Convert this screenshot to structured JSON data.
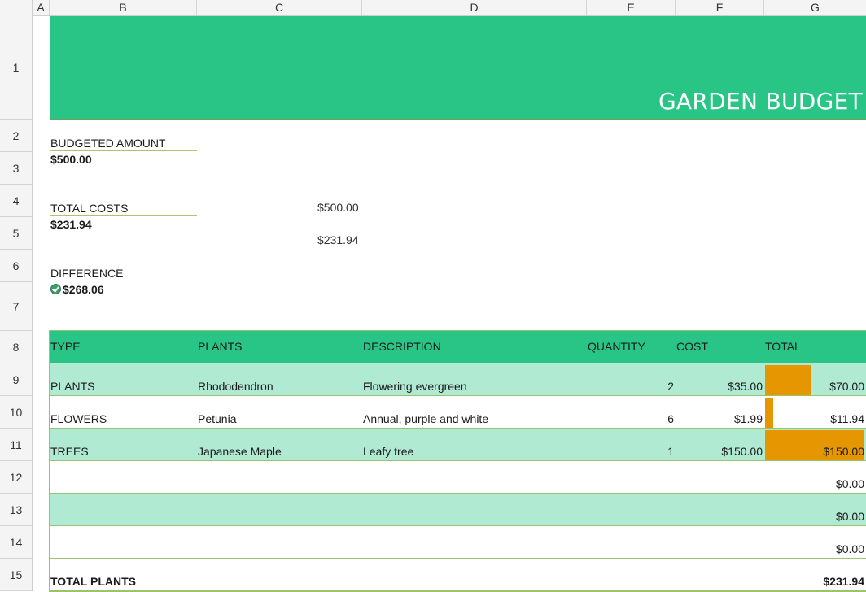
{
  "columns": [
    "A",
    "B",
    "C",
    "D",
    "E",
    "F",
    "G"
  ],
  "rows": [
    "1",
    "2",
    "3",
    "4",
    "5",
    "6",
    "7",
    "8",
    "9",
    "10",
    "11",
    "12",
    "13",
    "14",
    "15"
  ],
  "banner": {
    "title": "GARDEN BUDGET"
  },
  "summary": {
    "budget_label": "BUDGETED AMOUNT",
    "budget_value": "$500.00",
    "costs_label": "TOTAL COSTS",
    "costs_value": "$231.94",
    "difference_label": "DIFFERENCE",
    "difference_value": "$268.06",
    "chart_budget": "$500.00",
    "chart_costs": "$231.94"
  },
  "table": {
    "headers": [
      "TYPE",
      "PLANTS",
      "DESCRIPTION",
      "QUANTITY",
      "COST",
      "TOTAL"
    ],
    "items": [
      {
        "type": "PLANTS",
        "plant": "Rhododendron",
        "description": "Flowering evergreen",
        "quantity": "2",
        "cost": "$35.00",
        "total": "$70.00",
        "bar_fraction": 0.4667
      },
      {
        "type": "FLOWERS",
        "plant": "Petunia",
        "description": "Annual, purple and white",
        "quantity": "6",
        "cost": "$1.99",
        "total": "$11.94",
        "bar_fraction": 0.0796
      },
      {
        "type": "TREES",
        "plant": "Japanese Maple",
        "description": "Leafy tree",
        "quantity": "1",
        "cost": "$150.00",
        "total": "$150.00",
        "bar_fraction": 1.0
      },
      {
        "type": "",
        "plant": "",
        "description": "",
        "quantity": "",
        "cost": "",
        "total": "$0.00",
        "bar_fraction": 0
      },
      {
        "type": "",
        "plant": "",
        "description": "",
        "quantity": "",
        "cost": "",
        "total": "$0.00",
        "bar_fraction": 0
      },
      {
        "type": "",
        "plant": "",
        "description": "",
        "quantity": "",
        "cost": "",
        "total": "$0.00",
        "bar_fraction": 0
      }
    ],
    "footer_label": "TOTAL PLANTS",
    "footer_total": "$231.94"
  },
  "colors": {
    "accent": "#28c587",
    "row_alt": "#b1ead2",
    "bar": "#e69600"
  }
}
